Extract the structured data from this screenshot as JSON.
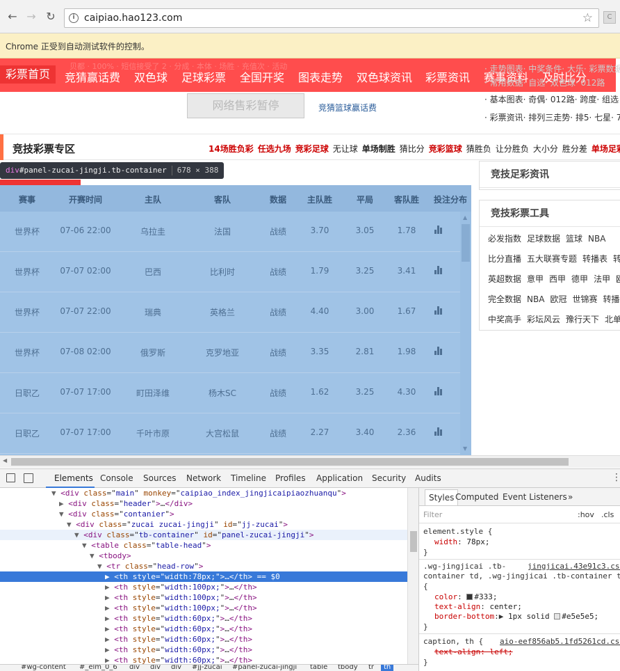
{
  "browser": {
    "url": "caipiao.hao123.com",
    "ext_label": "C",
    "automation_notice": "Chrome 正受到自动测试软件的控制。"
  },
  "nav": {
    "items": [
      "彩票首页",
      "竞猜赢话费",
      "双色球",
      "足球彩票",
      "全国开奖",
      "图表走势",
      "双色球资讯",
      "彩票资讯",
      "赛事资料",
      "及时比分"
    ],
    "ghost_text": "贝都 · 100% · 短信接受了 2 · 分成 · 本体 · 场胜 · 充值次 · 活动"
  },
  "right_links": [
    "· 走势图表· 中奖条件· 大乐· 彩票数据",
    "· 常用数据· 自选· 双色球· 012路",
    "· 基本图表· 奇偶· 012路· 跨度· 组选",
    "· 彩票资讯· 排列三走势· 排5· 七星· 7"
  ],
  "promo": {
    "sale_button": "网络售彩暂停",
    "basket_link": "竞猜篮球赢话费"
  },
  "section": {
    "title": "竞技彩票专区",
    "links": [
      {
        "text": "14场胜负彩",
        "style": "red"
      },
      {
        "text": "任选九场",
        "style": "red"
      },
      {
        "text": "竞彩足球",
        "style": "red"
      },
      {
        "text": "无让球",
        "style": "plain"
      },
      {
        "text": "单场制胜",
        "style": "black"
      },
      {
        "text": "猜比分",
        "style": "plain"
      },
      {
        "text": "竞彩篮球",
        "style": "red"
      },
      {
        "text": "猜胜负",
        "style": "plain"
      },
      {
        "text": "让分胜负",
        "style": "plain"
      },
      {
        "text": "大小分",
        "style": "plain"
      },
      {
        "text": "胜分差",
        "style": "plain"
      },
      {
        "text": "单场足彩",
        "style": "red"
      }
    ]
  },
  "tooltip": {
    "tag": "div",
    "selector": "#panel-zucai-jingji.tb-container",
    "dims": "678 × 388"
  },
  "table": {
    "headers": [
      "赛事",
      "开赛时间",
      "主队",
      "客队",
      "数据",
      "主队胜",
      "平局",
      "客队胜",
      "投注分布"
    ],
    "rows": [
      [
        "世界杯",
        "07-06 22:00",
        "乌拉圭",
        "法国",
        "战绩",
        "3.70",
        "3.05",
        "1.78"
      ],
      [
        "世界杯",
        "07-07 02:00",
        "巴西",
        "比利时",
        "战绩",
        "1.79",
        "3.25",
        "3.41"
      ],
      [
        "世界杯",
        "07-07 22:00",
        "瑞典",
        "英格兰",
        "战绩",
        "4.40",
        "3.00",
        "1.67"
      ],
      [
        "世界杯",
        "07-08 02:00",
        "俄罗斯",
        "克罗地亚",
        "战绩",
        "3.35",
        "2.81",
        "1.98"
      ],
      [
        "日职乙",
        "07-07 17:00",
        "町田泽维",
        "杨木SC",
        "战绩",
        "1.62",
        "3.25",
        "4.30"
      ],
      [
        "日职乙",
        "07-07 17:00",
        "千叶市原",
        "大宫松鼠",
        "战绩",
        "2.27",
        "3.40",
        "2.36"
      ]
    ]
  },
  "side": {
    "news_title": "竞技足彩资讯",
    "tools_title": "竞技彩票工具",
    "tool_rows": [
      [
        "必发指数",
        "足球数据",
        "篮球",
        "NBA"
      ],
      [
        "比分直播",
        "五大联赛专题",
        "转播表",
        "转"
      ],
      [
        "英超数据",
        "意甲",
        "西甲",
        "德甲",
        "法甲",
        "欧"
      ],
      [
        "完全数据",
        "NBA",
        "欧冠",
        "世锦赛",
        "转播"
      ],
      [
        "中奖高手",
        "彩坛风云",
        "豫行天下",
        "北单"
      ]
    ]
  },
  "devtools": {
    "tabs": [
      "Elements",
      "Console",
      "Sources",
      "Network",
      "Timeline",
      "Profiles",
      "Application",
      "Security",
      "Audits"
    ],
    "dom_lines": [
      {
        "indent": 6,
        "arrow": "▼",
        "html": "<span class='t'>&lt;div</span> <span class='a'>class</span>=\"<span class='v'>main</span>\" <span class='a'>monkey</span>=\"<span class='v'>caipiao_index_jingjicaipiaozhuanqu</span>\"<span class='t'>&gt;</span>"
      },
      {
        "indent": 7,
        "arrow": "▶",
        "html": "<span class='t'>&lt;div</span> <span class='a'>class</span>=\"<span class='v'>header</span>\"<span class='t'>&gt;</span>…<span class='t'>&lt;/div&gt;</span>"
      },
      {
        "indent": 7,
        "arrow": "▼",
        "html": "<span class='t'>&lt;div</span> <span class='a'>class</span>=\"<span class='v'>contanier</span>\"<span class='t'>&gt;</span>"
      },
      {
        "indent": 8,
        "arrow": "▼",
        "html": "<span class='t'>&lt;div</span> <span class='a'>class</span>=\"<span class='v'>zucai zucai-jingji</span>\" <span class='a'>id</span>=\"<span class='v'>jj-zucai</span>\"<span class='t'>&gt;</span>"
      },
      {
        "indent": 9,
        "arrow": "▼",
        "html": "<span class='t'>&lt;div</span> <span class='a'>class</span>=\"<span class='v'>tb-container</span>\" <span class='a'>id</span>=\"<span class='v'>panel-zucai-jingji</span>\"<span class='t'>&gt;</span>",
        "hover": true
      },
      {
        "indent": 10,
        "arrow": "▼",
        "html": "<span class='t'>&lt;table</span> <span class='a'>class</span>=\"<span class='v'>table-head</span>\"<span class='t'>&gt;</span>"
      },
      {
        "indent": 11,
        "arrow": "▼",
        "html": "<span class='t'>&lt;tbody&gt;</span>"
      },
      {
        "indent": 12,
        "arrow": "▼",
        "html": "<span class='t'>&lt;tr</span> <span class='a'>class</span>=\"<span class='v'>head-row</span>\"<span class='t'>&gt;</span>"
      },
      {
        "indent": 13,
        "arrow": "▶",
        "html": "<span class='t'>&lt;th</span> <span class='a'>style</span>=\"<span class='v'>width:78px;</span>\"<span class='t'>&gt;</span>…<span class='t'>&lt;/th&gt;</span> == $0",
        "sel": true
      },
      {
        "indent": 13,
        "arrow": "▶",
        "html": "<span class='t'>&lt;th</span> <span class='a'>style</span>=\"<span class='v'>width:100px;</span>\"<span class='t'>&gt;</span>…<span class='t'>&lt;/th&gt;</span>"
      },
      {
        "indent": 13,
        "arrow": "▶",
        "html": "<span class='t'>&lt;th</span> <span class='a'>style</span>=\"<span class='v'>width:100px;</span>\"<span class='t'>&gt;</span>…<span class='t'>&lt;/th&gt;</span>"
      },
      {
        "indent": 13,
        "arrow": "▶",
        "html": "<span class='t'>&lt;th</span> <span class='a'>style</span>=\"<span class='v'>width:100px;</span>\"<span class='t'>&gt;</span>…<span class='t'>&lt;/th&gt;</span>"
      },
      {
        "indent": 13,
        "arrow": "▶",
        "html": "<span class='t'>&lt;th</span> <span class='a'>style</span>=\"<span class='v'>width:60px;</span>\"<span class='t'>&gt;</span>…<span class='t'>&lt;/th&gt;</span>"
      },
      {
        "indent": 13,
        "arrow": "▶",
        "html": "<span class='t'>&lt;th</span> <span class='a'>style</span>=\"<span class='v'>width:60px;</span>\"<span class='t'>&gt;</span>…<span class='t'>&lt;/th&gt;</span>"
      },
      {
        "indent": 13,
        "arrow": "▶",
        "html": "<span class='t'>&lt;th</span> <span class='a'>style</span>=\"<span class='v'>width:60px;</span>\"<span class='t'>&gt;</span>…<span class='t'>&lt;/th&gt;</span>"
      },
      {
        "indent": 13,
        "arrow": "▶",
        "html": "<span class='t'>&lt;th</span> <span class='a'>style</span>=\"<span class='v'>width:60px;</span>\"<span class='t'>&gt;</span>…<span class='t'>&lt;/th&gt;</span>"
      },
      {
        "indent": 13,
        "arrow": "▶",
        "html": "<span class='t'>&lt;th</span> <span class='a'>style</span>=\"<span class='v'>width:60px;</span>\"<span class='t'>&gt;</span>…<span class='t'>&lt;/th&gt;</span>"
      }
    ],
    "breadcrumbs": [
      "#wg-content",
      "#_elm_0_6",
      "div",
      "div",
      "div",
      "#jj-zucai",
      "#panel-zucai-jingji",
      "table",
      "tbody",
      "tr",
      "th"
    ],
    "style_tabs": [
      "Styles",
      "Computed",
      "Event Listeners",
      "»"
    ],
    "filter_placeholder": "Filter",
    "hov": ":hov",
    "cls": ".cls",
    "rule1_selector": "element.style {",
    "rule1_prop": "width",
    "rule1_val": "78px;",
    "rule2_selector_a": ".wg-jingjicai .tb-",
    "rule2_source": "jingjicai.43e91c3.css",
    "rule2_selector_b": "container td, .wg-jingjicai .tb-container th",
    "rule2_color_prop": "color",
    "rule2_color_val": "#333;",
    "rule2_align_prop": "text-align",
    "rule2_align_val": "center;",
    "rule2_border_prop": "border-bottom",
    "rule2_border_val": "1px solid",
    "rule2_border_color": "#e5e5e5;",
    "rule3_selector": "caption, th {",
    "rule3_source": "aio-eef856ab5.1fd5261cd.css",
    "rule3_prop": "text-align: left;",
    "brace_open": "{",
    "brace_close": "}"
  }
}
